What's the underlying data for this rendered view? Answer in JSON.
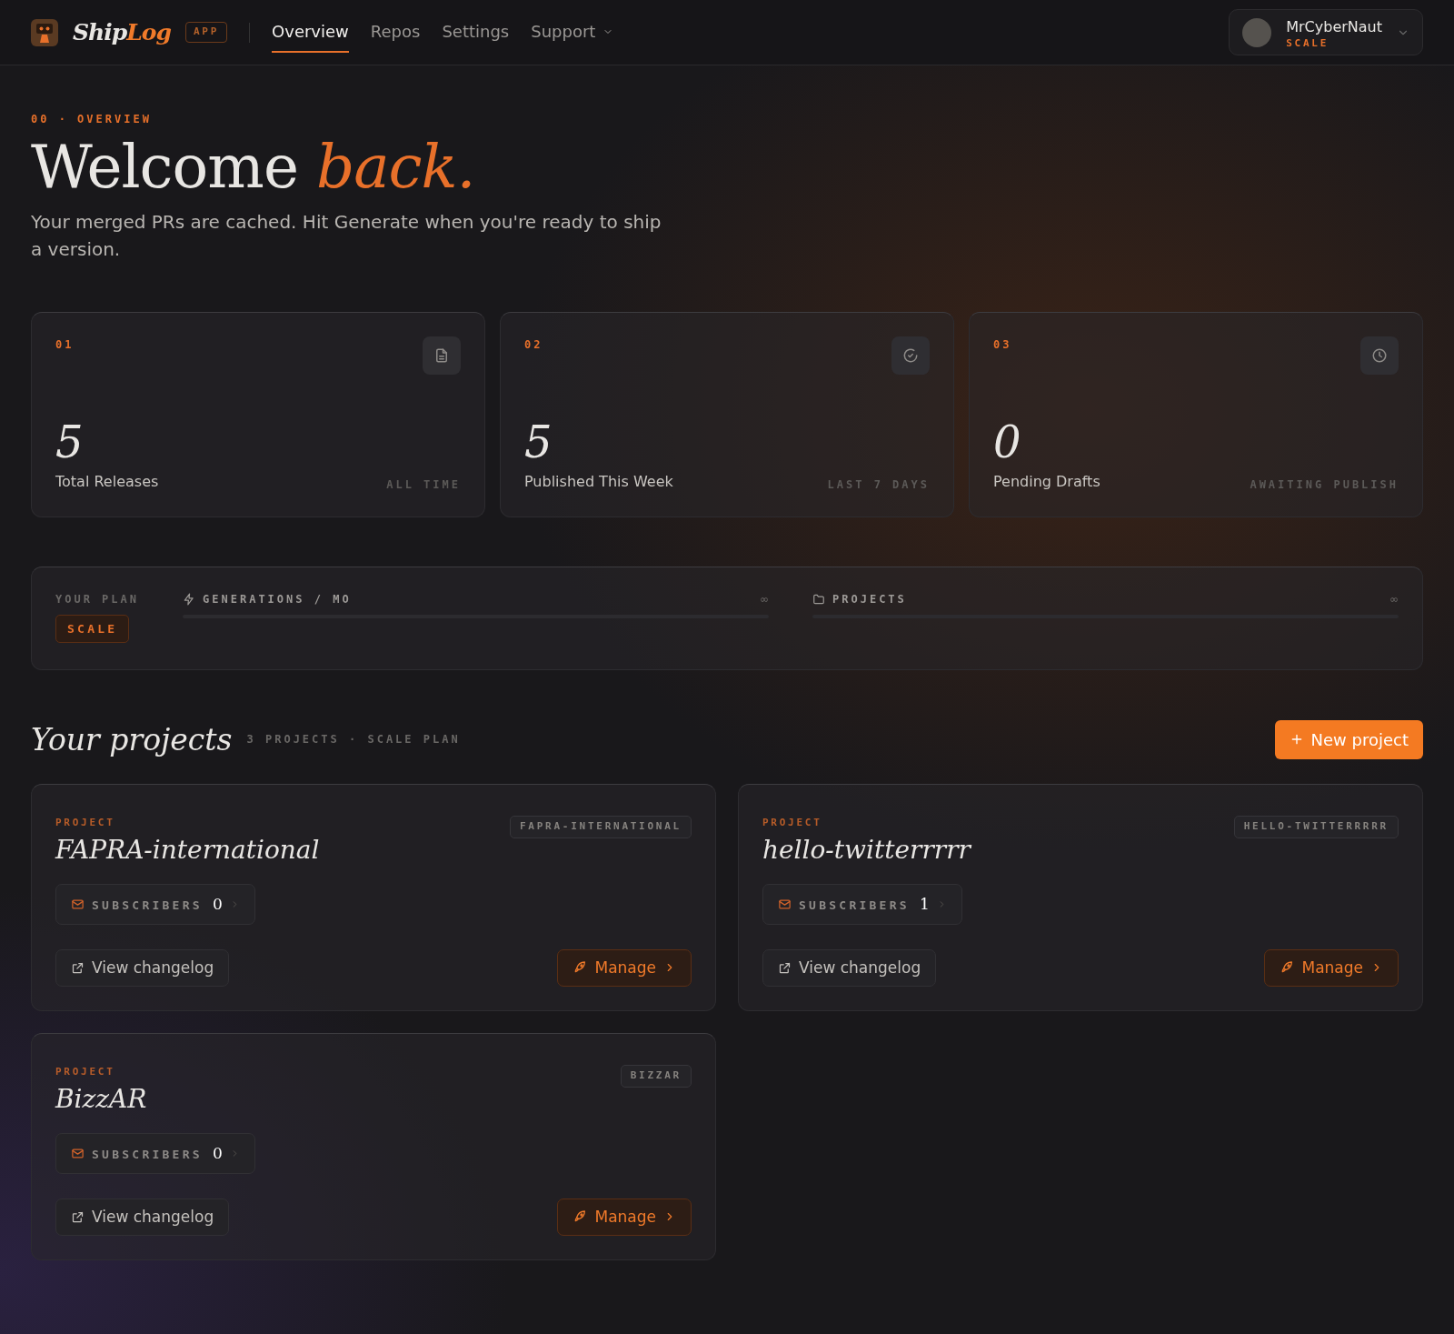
{
  "navbar": {
    "brand": {
      "first": "Ship",
      "second": "Log",
      "badge": "APP"
    },
    "tabs": [
      {
        "label": "Overview",
        "selected": true,
        "dropdown": false
      },
      {
        "label": "Repos",
        "selected": false,
        "dropdown": false
      },
      {
        "label": "Settings",
        "selected": false,
        "dropdown": false
      },
      {
        "label": "Support",
        "selected": false,
        "dropdown": true
      }
    ],
    "user": {
      "name": "MrCyberNaut",
      "plan": "SCALE"
    }
  },
  "hero": {
    "eyebrow": "00 · OVERVIEW",
    "title": "Welcome",
    "title_accent": "back.",
    "subtitle": "Your merged PRs are cached. Hit Generate when you're ready to ship a version."
  },
  "stats": [
    {
      "index": "01",
      "kind": "document",
      "value": "5",
      "label": "Total Releases",
      "period": "ALL TIME"
    },
    {
      "index": "02",
      "kind": "check",
      "value": "5",
      "label": "Published This Week",
      "period": "LAST 7 DAYS"
    },
    {
      "index": "03",
      "kind": "clock",
      "value": "0",
      "label": "Pending Drafts",
      "period": "AWAITING PUBLISH"
    }
  ],
  "plan": {
    "label": "YOUR PLAN",
    "name": "SCALE",
    "meters": [
      {
        "kind": "bolt",
        "label": "GENERATIONS / MO",
        "limit": "∞",
        "level": 0
      },
      {
        "kind": "folder",
        "label": "PROJECTS",
        "limit": "∞",
        "level": 0
      }
    ]
  },
  "projects": {
    "title": "Your projects",
    "meta": "3 PROJECTS · SCALE PLAN",
    "new_button": "New project",
    "items": [
      {
        "eyebrow": "PROJECT",
        "name": "FAPRA-international",
        "slug": "FAPRA-INTERNATIONAL",
        "subscribers_label": "SUBSCRIBERS",
        "subscribers": "0",
        "changelog": "View changelog",
        "manage": "Manage"
      },
      {
        "eyebrow": "PROJECT",
        "name": "hello-twitterrrrr",
        "slug": "HELLO-TWITTERRRRR",
        "subscribers_label": "SUBSCRIBERS",
        "subscribers": "1",
        "changelog": "View changelog",
        "manage": "Manage"
      },
      {
        "eyebrow": "PROJECT",
        "name": "BizzAR",
        "slug": "BIZZAR",
        "subscribers_label": "SUBSCRIBERS",
        "subscribers": "0",
        "changelog": "View changelog",
        "manage": "Manage"
      }
    ]
  }
}
